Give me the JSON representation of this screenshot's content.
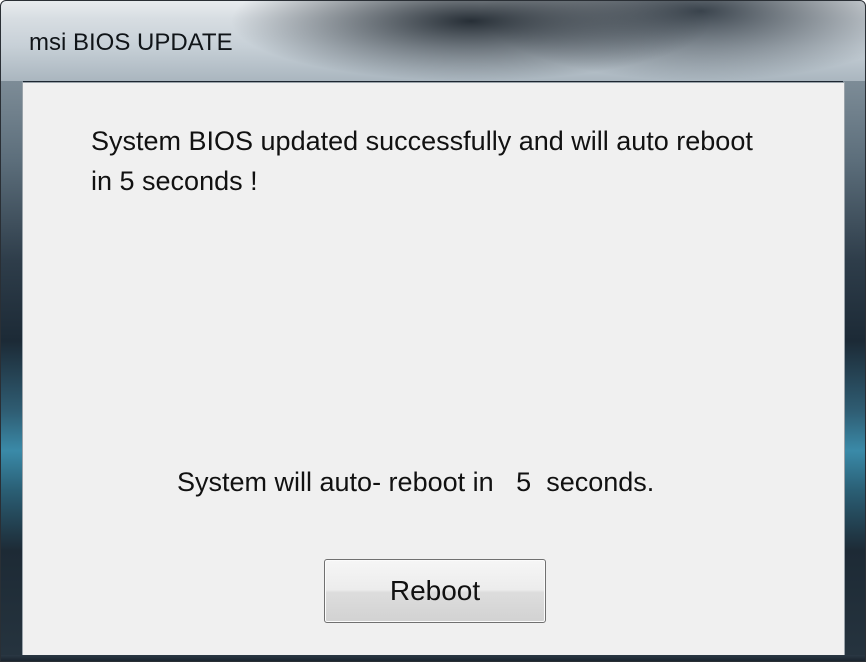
{
  "window": {
    "title": "msi BIOS UPDATE"
  },
  "dialog": {
    "message": "System BIOS updated successfully and will auto reboot in 5 seconds !",
    "countdown": {
      "prefix": "System will auto- reboot in",
      "seconds": "5",
      "suffix": "seconds."
    },
    "reboot_button_label": "Reboot"
  },
  "colors": {
    "client_background": "#f0f0f0",
    "text": "#111111"
  }
}
